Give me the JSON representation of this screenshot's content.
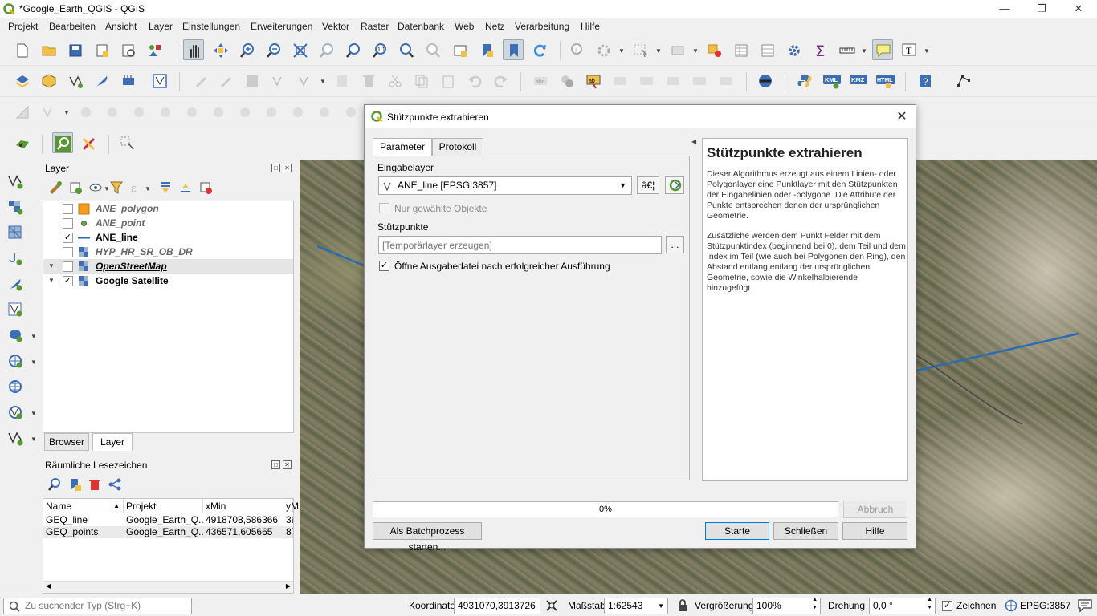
{
  "window": {
    "title": "*Google_Earth_QGIS - QGIS"
  },
  "menu": [
    "Projekt",
    "Bearbeiten",
    "Ansicht",
    "Layer",
    "Einstellungen",
    "Erweiterungen",
    "Vektor",
    "Raster",
    "Datenbank",
    "Web",
    "Netz",
    "Verarbeitung",
    "Hilfe"
  ],
  "layers_panel": {
    "title": "Layer",
    "layers": [
      {
        "name": "ANE_polygon",
        "checked": false,
        "style": "inactive"
      },
      {
        "name": "ANE_point",
        "checked": false,
        "style": "inactive"
      },
      {
        "name": "ANE_line",
        "checked": true,
        "style": "active"
      },
      {
        "name": "HYP_HR_SR_OB_DR",
        "checked": false,
        "style": "inactive"
      },
      {
        "name": "OpenStreetMap",
        "checked": false,
        "style": "selected"
      },
      {
        "name": "Google Satellite",
        "checked": true,
        "style": "active"
      }
    ],
    "tabs": [
      "Browser",
      "Layer"
    ]
  },
  "bookmarks_panel": {
    "title": "Räumliche Lesezeichen",
    "columns": [
      "Name",
      "Projekt",
      "xMin",
      "yM"
    ],
    "rows": [
      [
        "GEQ_line",
        "Google_Earth_Q...",
        "4918708,586366",
        "39"
      ],
      [
        "GEQ_points",
        "Google_Earth_Q...",
        "436571,605665",
        "87"
      ]
    ]
  },
  "dialog": {
    "title": "Stützpunkte extrahieren",
    "tabs": [
      "Parameter",
      "Protokoll"
    ],
    "input_layer_label": "Eingabelayer",
    "input_layer_value": "ANE_line [EPSG:3857]",
    "iter_button": "â€¦",
    "selected_only_label": "Nur gewählte Objekte",
    "output_label": "Stützpunkte",
    "output_placeholder": "[Temporärlayer erzeugen]",
    "browse_button": "...",
    "open_output_label": "Öffne Ausgabedatei nach erfolgreicher Ausführung",
    "help_title": "Stützpunkte extrahieren",
    "help_text_1": "Dieser Algorithmus erzeugt aus einem Linien- oder Polygonlayer eine Punktlayer mit den Stützpunkten der Eingabelinien oder -polygone. Die Attribute der Punkte entsprechen denen der ursprünglichen Geometrie.",
    "help_text_2": "Zusätzliche werden dem Punkt Felder mit dem Stützpunktindex (beginnend bei 0), dem Teil und dem Index im Teil (wie auch bei Polygonen den Ring), den Abstand entlang entlang der ursprünglichen Geometrie, sowie die Winkelhalbierende hinzugefügt.",
    "progress": "0%",
    "cancel_button": "Abbruch",
    "batch_button": "Als Batchprozess starten...",
    "run_button": "Starte",
    "close_button": "Schließen",
    "help_button": "Hilfe"
  },
  "statusbar": {
    "search_placeholder": "Zu suchender Typ (Strg+K)",
    "coord_label": "Koordinate",
    "coord_value": "4931070,3913726",
    "scale_label": "Maßstab",
    "scale_value": "1:62543",
    "magnifier_label": "Vergrößerung",
    "magnifier_value": "100%",
    "rotation_label": "Drehung",
    "rotation_value": "0,0 °",
    "render_label": "Zeichnen",
    "crs": "EPSG:3857"
  },
  "colors": {
    "accent": "#0078d7",
    "qgis_green": "#589632",
    "line_blue": "#2a6bb5"
  }
}
